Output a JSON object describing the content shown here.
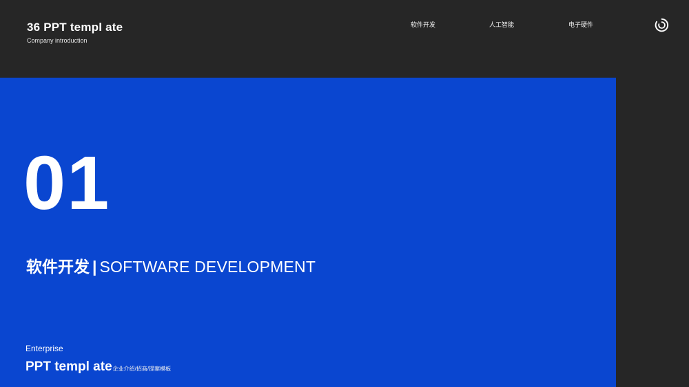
{
  "header": {
    "title": "36 PPT templ ate",
    "subtitle": "Company introduction",
    "nav": [
      {
        "label": "软件开发"
      },
      {
        "label": "人工智能"
      },
      {
        "label": "电子硬件"
      }
    ],
    "logo_icon": "ring-logo-icon"
  },
  "main": {
    "number": "01",
    "headline_cn": "软件开发",
    "headline_sep": "|",
    "headline_en": "SOFTWARE DEVELOPMENT"
  },
  "footer": {
    "enterprise": "Enterprise",
    "title": "PPT templ ate",
    "subtitle": "企业介绍/招商/提案模板"
  },
  "colors": {
    "background": "#262626",
    "panel_blue": "#0a46d0",
    "text": "#ffffff"
  }
}
